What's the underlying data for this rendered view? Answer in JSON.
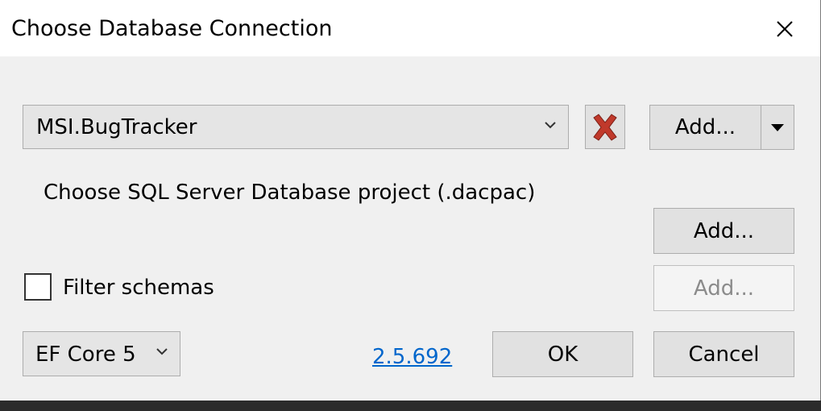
{
  "window": {
    "title": "Choose Database Connection"
  },
  "connection": {
    "selected": "MSI.BugTracker",
    "add_label": "Add..."
  },
  "dacpac": {
    "label": "Choose SQL Server Database project (.dacpac)",
    "add_label": "Add..."
  },
  "filter": {
    "label": "Filter schemas",
    "checked": false,
    "add_label": "Add..."
  },
  "footer": {
    "ef_version": "EF Core 5",
    "version_link": "2.5.692",
    "ok_label": "OK",
    "cancel_label": "Cancel"
  },
  "colors": {
    "link": "#0066cc",
    "delete_icon": "#c0392b",
    "button_bg": "#e1e1e1"
  },
  "icons": {
    "close": "close-icon",
    "delete": "delete-x-icon",
    "dropdown": "chevron-down-icon",
    "split_arrow": "triangle-down-icon"
  }
}
